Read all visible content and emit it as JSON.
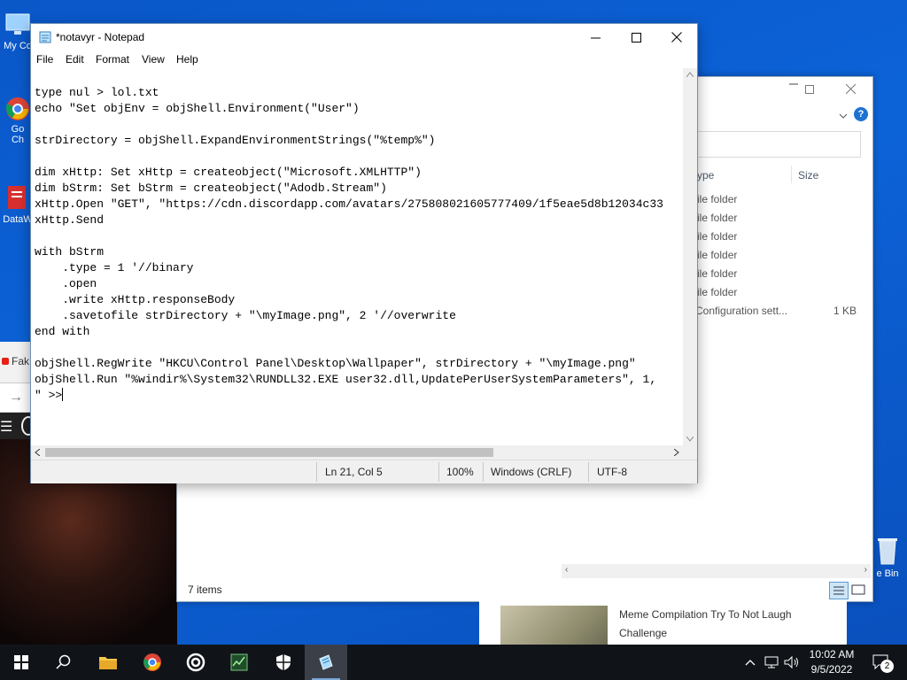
{
  "desktop": {
    "icons": [
      {
        "label": "My Co"
      },
      {
        "label": "Go"
      },
      {
        "label": "Ch"
      },
      {
        "label": "DataW"
      }
    ],
    "recycle_label": "e Bin"
  },
  "background_browser": {
    "tab_label": "Fak"
  },
  "explorer": {
    "col_type": "ype",
    "col_size": "Size",
    "rows": [
      {
        "type": "ile folder",
        "size": ""
      },
      {
        "type": "ile folder",
        "size": ""
      },
      {
        "type": "ile folder",
        "size": ""
      },
      {
        "type": "ile folder",
        "size": ""
      },
      {
        "type": "ile folder",
        "size": ""
      },
      {
        "type": "ile folder",
        "size": ""
      },
      {
        "type": "Configuration sett...",
        "size": "1 KB"
      }
    ],
    "status": "7 items"
  },
  "video_card": {
    "title": "Meme Compilation Try To Not Laugh Challenge"
  },
  "notepad": {
    "title": "*notavyr - Notepad",
    "menu": [
      "File",
      "Edit",
      "Format",
      "View",
      "Help"
    ],
    "content": "type nul > lol.txt\necho \"Set objEnv = objShell.Environment(\"User\")\n\nstrDirectory = objShell.ExpandEnvironmentStrings(\"%temp%\")\n\ndim xHttp: Set xHttp = createobject(\"Microsoft.XMLHTTP\")\ndim bStrm: Set bStrm = createobject(\"Adodb.Stream\")\nxHttp.Open \"GET\", \"https://cdn.discordapp.com/avatars/275808021605777409/1f5eae5d8b12034c33\nxHttp.Send\n\nwith bStrm\n    .type = 1 '//binary\n    .open\n    .write xHttp.responseBody\n    .savetofile strDirectory + \"\\myImage.png\", 2 '//overwrite\nend with\n\nobjShell.RegWrite \"HKCU\\Control Panel\\Desktop\\Wallpaper\", strDirectory + \"\\myImage.png\"\nobjShell.Run \"%windir%\\System32\\RUNDLL32.EXE user32.dll,UpdatePerUserSystemParameters\", 1,\n\" >>",
    "status": {
      "position": "Ln 21, Col 5",
      "zoom": "100%",
      "line_ending": "Windows (CRLF)",
      "encoding": "UTF-8"
    }
  },
  "taskbar": {
    "time": "10:02 AM",
    "date": "9/5/2022",
    "notification_count": "2"
  },
  "colors": {
    "desktop": "#0c63d8",
    "taskbar": "#101418",
    "accent": "#0078d7"
  }
}
